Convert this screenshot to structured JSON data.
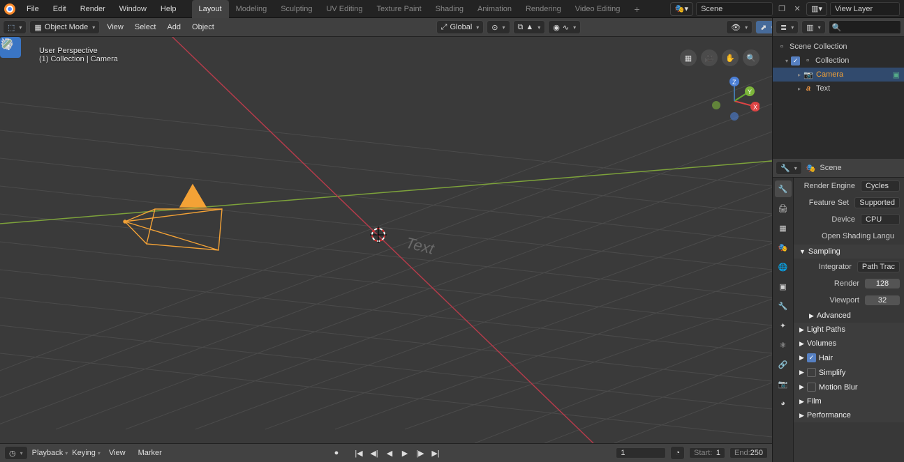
{
  "topmenu": [
    "File",
    "Edit",
    "Render",
    "Window",
    "Help"
  ],
  "workspaces": {
    "items": [
      "Layout",
      "Modeling",
      "Sculpting",
      "UV Editing",
      "Texture Paint",
      "Shading",
      "Animation",
      "Rendering",
      "Video Editing"
    ],
    "active": 0
  },
  "scene_field": "Scene",
  "viewlayer_field": "View Layer",
  "mode": "Object Mode",
  "header_menus": [
    "View",
    "Select",
    "Add",
    "Object"
  ],
  "orientation": "Global",
  "viewport": {
    "line1": "User Perspective",
    "line2": "(1) Collection | Camera",
    "text_obj": "Text"
  },
  "outliner": {
    "root": "Scene Collection",
    "coll": "Collection",
    "items": [
      {
        "name": "Camera",
        "active": true
      },
      {
        "name": "Text",
        "active": false
      }
    ]
  },
  "properties": {
    "scene_breadcrumb": "Scene",
    "render_engine_label": "Render Engine",
    "render_engine": "Cycles",
    "feature_set_label": "Feature Set",
    "feature_set": "Supported",
    "device_label": "Device",
    "device": "CPU",
    "osl_label": "Open Shading Langu",
    "sampling_label": "Sampling",
    "integrator_label": "Integrator",
    "integrator": "Path Trac",
    "render_label": "Render",
    "render_samples": "128",
    "viewport_label": "Viewport",
    "viewport_samples": "32",
    "advanced": "Advanced",
    "panels": [
      "Light Paths",
      "Volumes",
      "Hair",
      "Simplify",
      "Motion Blur",
      "Film",
      "Performance"
    ],
    "hair_checked": true,
    "simplify_checked": false,
    "motionblur_checked": false
  },
  "timeline": {
    "menus": [
      "Playback",
      "Keying",
      "View",
      "Marker"
    ],
    "frame": "1",
    "start_label": "Start:",
    "start": "1",
    "end_label": "End:",
    "end": "250"
  }
}
